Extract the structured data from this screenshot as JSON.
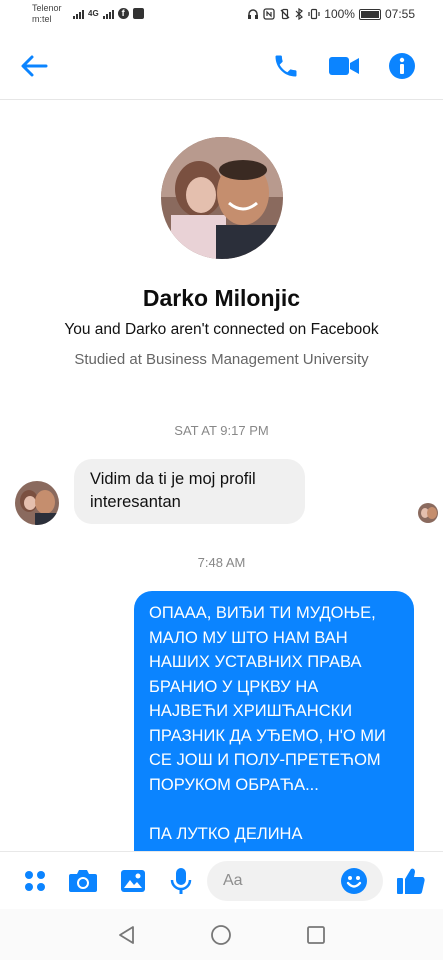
{
  "status_bar": {
    "carrier_line1": "Telenor",
    "carrier_line2": "m:tel",
    "network": "4G",
    "battery": "100%",
    "time": "07:55"
  },
  "header": {
    "back_icon": "back-arrow-icon",
    "call_icon": "phone-icon",
    "video_icon": "video-camera-icon",
    "info_icon": "info-icon",
    "accent_color": "#0b84ff"
  },
  "profile": {
    "name": "Darko Milonjic",
    "connection_note": "You and Darko aren't connected on Facebook",
    "education": "Studied at Business Management University"
  },
  "conversation": {
    "timestamp_1": "SAT AT 9:17 PM",
    "incoming_message": "Vidim da ti je moj profil interesantan",
    "timestamp_2": "7:48 AM",
    "outgoing_message": "ОПААА, ВИЂИ ТИ МУДОЊЕ, МАЛО МУ ШТО НАМ ВАН НАШИХ УСТАВНИХ ПРАВА БРАНИО У ЦРКВУ НА НАЈВЕЋИ ХРИШЋАНСКИ ПРАЗНИК ДА УЂЕМО, Н'О МИ СЕ ЈОШ И ПОЛУ-ПРЕТЕЋОМ ПОРУКОМ ОБРАЋА...\n\nПА ЛУТКО ДЕЛИНА",
    "outgoing_color": "#0b84ff",
    "incoming_color": "#f0f0f0"
  },
  "composer": {
    "placeholder": "Aa",
    "icons": [
      "more-apps-icon",
      "camera-icon",
      "gallery-icon",
      "microphone-icon",
      "emoji-icon",
      "thumbs-up-icon"
    ]
  },
  "navbar": {
    "icons": [
      "back-triangle-icon",
      "home-circle-icon",
      "recents-square-icon"
    ]
  }
}
